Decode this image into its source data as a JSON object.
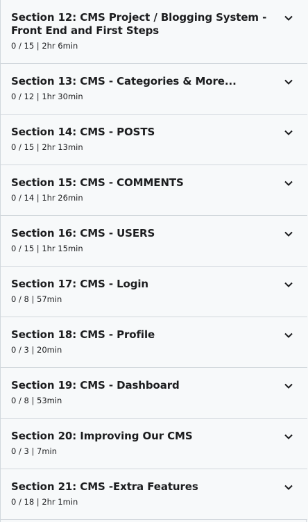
{
  "sections": [
    {
      "title": "Section 12: CMS Project / Blogging System - Front End and First Steps",
      "meta": "0 / 15 | 2hr 6min"
    },
    {
      "title": "Section 13: CMS - Categories & More...",
      "meta": "0 / 12 | 1hr 30min"
    },
    {
      "title": "Section 14: CMS - POSTS",
      "meta": "0 / 15 | 2hr 13min"
    },
    {
      "title": "Section 15: CMS - COMMENTS",
      "meta": "0 / 14 | 1hr 26min"
    },
    {
      "title": "Section 16: CMS - USERS",
      "meta": "0 / 15 | 1hr 15min"
    },
    {
      "title": "Section 17: CMS - Login",
      "meta": "0 / 8 | 57min"
    },
    {
      "title": "Section 18: CMS - Profile",
      "meta": "0 / 3 | 20min"
    },
    {
      "title": "Section 19: CMS - Dashboard",
      "meta": "0 / 8 | 53min"
    },
    {
      "title": "Section 20: Improving Our CMS",
      "meta": "0 / 3 | 7min"
    },
    {
      "title": "Section 21: CMS -Extra Features",
      "meta": "0 / 18 | 2hr 1min"
    }
  ],
  "icons": {
    "expand": "chevron-down-icon"
  }
}
